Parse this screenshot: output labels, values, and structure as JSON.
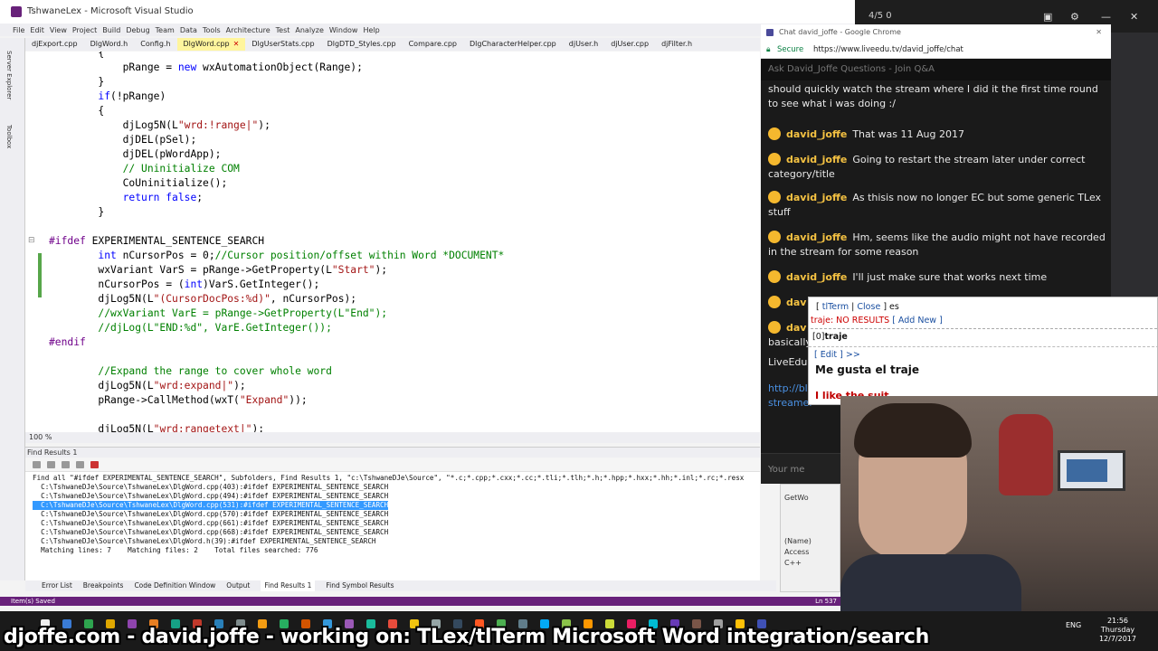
{
  "vs": {
    "title": "TshwaneLex - Microsoft Visual Studio",
    "menu": [
      "File",
      "Edit",
      "View",
      "Project",
      "Build",
      "Debug",
      "Team",
      "Data",
      "Tools",
      "Architecture",
      "Test",
      "Analyze",
      "Window",
      "Help"
    ],
    "tabs": [
      "djExport.cpp",
      "DlgWord.h",
      "Config.h",
      "DlgWord.cpp",
      "DlgUserStats.cpp",
      "DlgDTD_Styles.cpp",
      "Compare.cpp",
      "DlgCharacterHelper.cpp",
      "djUser.h",
      "djUser.cpp",
      "djFilter.h"
    ],
    "active_tab": "DlgWord.cpp",
    "toolstrip": [
      "Server Explorer",
      "Toolbox"
    ],
    "zoom": "100 %",
    "code": [
      {
        "indent": "        ",
        "parts": [
          [
            "t",
            "{"
          ]
        ]
      },
      {
        "indent": "            ",
        "parts": [
          [
            "t",
            "pRange = "
          ],
          [
            "kw",
            "new"
          ],
          [
            "t",
            " wxAutomationObject(Range);"
          ]
        ]
      },
      {
        "indent": "        ",
        "parts": [
          [
            "t",
            "}"
          ]
        ]
      },
      {
        "indent": "        ",
        "parts": [
          [
            "kw",
            "if"
          ],
          [
            "t",
            "(!pRange)"
          ]
        ]
      },
      {
        "indent": "        ",
        "parts": [
          [
            "t",
            "{"
          ]
        ]
      },
      {
        "indent": "            ",
        "parts": [
          [
            "t",
            "djLog5N(L"
          ],
          [
            "str",
            "\"wrd:!range|\""
          ],
          [
            "t",
            ");"
          ]
        ]
      },
      {
        "indent": "            ",
        "parts": [
          [
            "t",
            "djDEL(pSel);"
          ]
        ]
      },
      {
        "indent": "            ",
        "parts": [
          [
            "t",
            "djDEL(pWordApp);"
          ]
        ]
      },
      {
        "indent": "            ",
        "parts": [
          [
            "cm",
            "// Uninitialize COM"
          ]
        ]
      },
      {
        "indent": "            ",
        "parts": [
          [
            "t",
            "CoUninitialize();"
          ]
        ]
      },
      {
        "indent": "            ",
        "parts": [
          [
            "kw",
            "return"
          ],
          [
            "t",
            " "
          ],
          [
            "kw",
            "false"
          ],
          [
            "t",
            ";"
          ]
        ]
      },
      {
        "indent": "        ",
        "parts": [
          [
            "t",
            "}"
          ]
        ]
      },
      {
        "indent": "",
        "parts": []
      },
      {
        "indent": "",
        "parts": [
          [
            "pp",
            "#ifdef"
          ],
          [
            "t",
            " EXPERIMENTAL_SENTENCE_SEARCH"
          ]
        ]
      },
      {
        "indent": "        ",
        "parts": [
          [
            "kw",
            "int"
          ],
          [
            "t",
            " nCursorPos = 0;"
          ],
          [
            "cm",
            "//Cursor position/offset within Word *DOCUMENT*"
          ]
        ]
      },
      {
        "indent": "        ",
        "parts": [
          [
            "t",
            "wxVariant VarS = pRange->GetProperty(L"
          ],
          [
            "str",
            "\"Start\""
          ],
          [
            "t",
            ");"
          ]
        ]
      },
      {
        "indent": "        ",
        "parts": [
          [
            "t",
            "nCursorPos = ("
          ],
          [
            "kw",
            "int"
          ],
          [
            "t",
            ")VarS.GetInteger();"
          ]
        ]
      },
      {
        "indent": "        ",
        "parts": [
          [
            "t",
            "djLog5N(L"
          ],
          [
            "str",
            "\"(CursorDocPos:%d)\""
          ],
          [
            "t",
            ", nCursorPos);"
          ]
        ]
      },
      {
        "indent": "        ",
        "parts": [
          [
            "cm",
            "//wxVariant VarE = pRange->GetProperty(L\"End\");"
          ]
        ]
      },
      {
        "indent": "        ",
        "parts": [
          [
            "cm",
            "//djLog(L\"END:%d\", VarE.GetInteger());"
          ]
        ]
      },
      {
        "indent": "",
        "parts": [
          [
            "pp",
            "#endif"
          ]
        ]
      },
      {
        "indent": "",
        "parts": []
      },
      {
        "indent": "        ",
        "parts": [
          [
            "cm",
            "//Expand the range to cover whole word"
          ]
        ]
      },
      {
        "indent": "        ",
        "parts": [
          [
            "t",
            "djLog5N(L"
          ],
          [
            "str",
            "\"wrd:expand|\""
          ],
          [
            "t",
            ");"
          ]
        ]
      },
      {
        "indent": "        ",
        "parts": [
          [
            "t",
            "pRange->CallMethod(wxT("
          ],
          [
            "str",
            "\"Expand\""
          ],
          [
            "t",
            "));"
          ]
        ]
      },
      {
        "indent": "",
        "parts": []
      },
      {
        "indent": "        ",
        "parts": [
          [
            "t",
            "djLog5N(L"
          ],
          [
            "str",
            "\"wrd:rangetext|\""
          ],
          [
            "t",
            ");"
          ]
        ]
      }
    ],
    "find": {
      "title": "Find Results 1",
      "lines": [
        "Find all \"#ifdef EXPERIMENTAL_SENTENCE_SEARCH\", Subfolders, Find Results 1, \"c:\\TshwaneDJe\\Source\", \"*.c;*.cpp;*.cxx;*.cc;*.tli;*.tlh;*.h;*.hpp;*.hxx;*.hh;*.inl;*.rc;*.resx",
        "  C:\\TshwaneDJe\\Source\\TshwaneLex\\DlgWord.cpp(403):#ifdef EXPERIMENTAL_SENTENCE_SEARCH",
        "  C:\\TshwaneDJe\\Source\\TshwaneLex\\DlgWord.cpp(494):#ifdef EXPERIMENTAL_SENTENCE_SEARCH",
        "  C:\\TshwaneDJe\\Source\\TshwaneLex\\DlgWord.cpp(531):#ifdef EXPERIMENTAL_SENTENCE_SEARCH",
        "  C:\\TshwaneDJe\\Source\\TshwaneLex\\DlgWord.cpp(570):#ifdef EXPERIMENTAL_SENTENCE_SEARCH",
        "  C:\\TshwaneDJe\\Source\\TshwaneLex\\DlgWord.cpp(661):#ifdef EXPERIMENTAL_SENTENCE_SEARCH",
        "  C:\\TshwaneDJe\\Source\\TshwaneLex\\DlgWord.cpp(668):#ifdef EXPERIMENTAL_SENTENCE_SEARCH",
        "  C:\\TshwaneDJe\\Source\\TshwaneLex\\DlgWord.h(39):#ifdef EXPERIMENTAL_SENTENCE_SEARCH",
        "  Matching lines: 7    Matching files: 2    Total files searched: 776"
      ],
      "selected_index": 3
    },
    "bottom_tabs": [
      "Error List",
      "Breakpoints",
      "Code Definition Window",
      "Output",
      "Find Results 1",
      "Find Symbol Results"
    ],
    "active_bottom_tab": "Find Results 1",
    "status": "Item(s) Saved",
    "line_indicator": "Ln 537"
  },
  "topstrip": {
    "info": "4/5    0"
  },
  "chrome": {
    "title": "Chat david_joffe - Google Chrome",
    "secure": "Secure",
    "url": "https://www.liveedu.tv/david_joffe/chat",
    "chat_header": "Ask David_Joffe Questions - Join Q&A",
    "messages": [
      {
        "user": "",
        "text": "should quickly watch the stream where I did it the first time round to see what i was doing :/"
      },
      {
        "user": "david_joffe",
        "text": "That was 11 Aug 2017"
      },
      {
        "user": "david_joffe",
        "text": "Going to restart the stream later under correct category/title"
      },
      {
        "user": "david_joffe",
        "text": "As thisis now no longer EC but some generic TLex stuff"
      },
      {
        "user": "david_joffe",
        "text": "Hm, seems like the audio might not have recorded in the stream for some reason"
      },
      {
        "user": "david_joffe",
        "text": "I'll just make sure that works next time"
      },
      {
        "user": "dav",
        "text": ""
      },
      {
        "user": "dav",
        "text": ""
      }
    ],
    "partial_text": [
      "basically",
      "LiveEdu"
    ],
    "link_text": [
      "http://bl",
      "streamer"
    ],
    "input_placeholder": "Your me"
  },
  "tlterm": {
    "tab_open": "[",
    "tab_tlterm": "tlTerm",
    "tab_sep": "|",
    "tab_close": "Close",
    "tab_end": "] es",
    "query": "traje",
    "no_results": ": NO RESULTS",
    "add_new": "[ Add New ]",
    "result_prefix": "[0]",
    "result_word": "traje",
    "edit": "[ Edit ] >>",
    "example_es": "Me gusta el traje",
    "example_en": "I like the suit"
  },
  "mini_panel": [
    "GetWo",
    "(Name)",
    "Access",
    "C++"
  ],
  "taskbar": {
    "lang": "ENG",
    "time": "21:56",
    "day": "Thursday",
    "date": "12/7/2017"
  },
  "banner": "djoffe.com - david.joffe - working on: TLex/tlTerm Microsoft Word integration/search",
  "colors": {
    "vs_purple": "#68217a",
    "keyword": "#0000ff",
    "string": "#a31515",
    "comment": "#008000",
    "preproc": "#6f008a",
    "selection": "#3399ff",
    "chat_user": "#f5c242"
  }
}
